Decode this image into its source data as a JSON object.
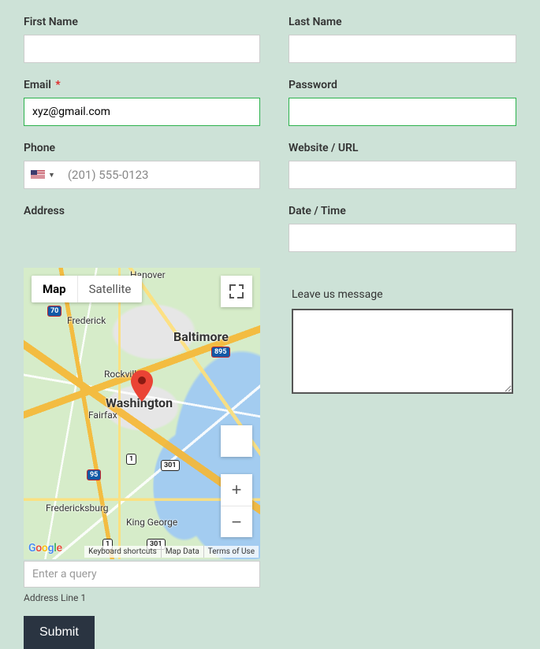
{
  "labels": {
    "first_name": "First Name",
    "last_name": "Last Name",
    "email": "Email",
    "password": "Password",
    "phone": "Phone",
    "website": "Website / URL",
    "address": "Address",
    "date_time": "Date / Time",
    "message": "Leave us message",
    "address_line_1": "Address Line 1",
    "required_star": "*"
  },
  "values": {
    "first_name": "",
    "last_name": "",
    "email": "xyz@gmail.com",
    "password": "",
    "phone": "",
    "website": "",
    "date_time": "",
    "message": "",
    "address_query": ""
  },
  "placeholders": {
    "phone": "(201) 555-0123",
    "address_query": "Enter a query"
  },
  "map": {
    "type_buttons": {
      "map": "Map",
      "satellite": "Satellite"
    },
    "zoom_plus": "+",
    "zoom_minus": "−",
    "attributions": [
      "Keyboard shortcuts",
      "Map Data",
      "Terms of Use"
    ],
    "places": {
      "baltimore": "Baltimore",
      "washington": "Washington",
      "frederick": "Frederick",
      "rockville": "Rockville",
      "fairfax": "Fairfax",
      "fredericksburg": "Fredericksburg",
      "king_george": "King George",
      "hanover": "Hanover"
    },
    "shields": {
      "i70": "70",
      "i95": "95",
      "i895": "895",
      "us1a": "1",
      "us301a": "301",
      "us301b": "301",
      "us1b": "1"
    },
    "google": [
      "G",
      "o",
      "o",
      "g",
      "l",
      "e"
    ]
  },
  "submit": "Submit"
}
